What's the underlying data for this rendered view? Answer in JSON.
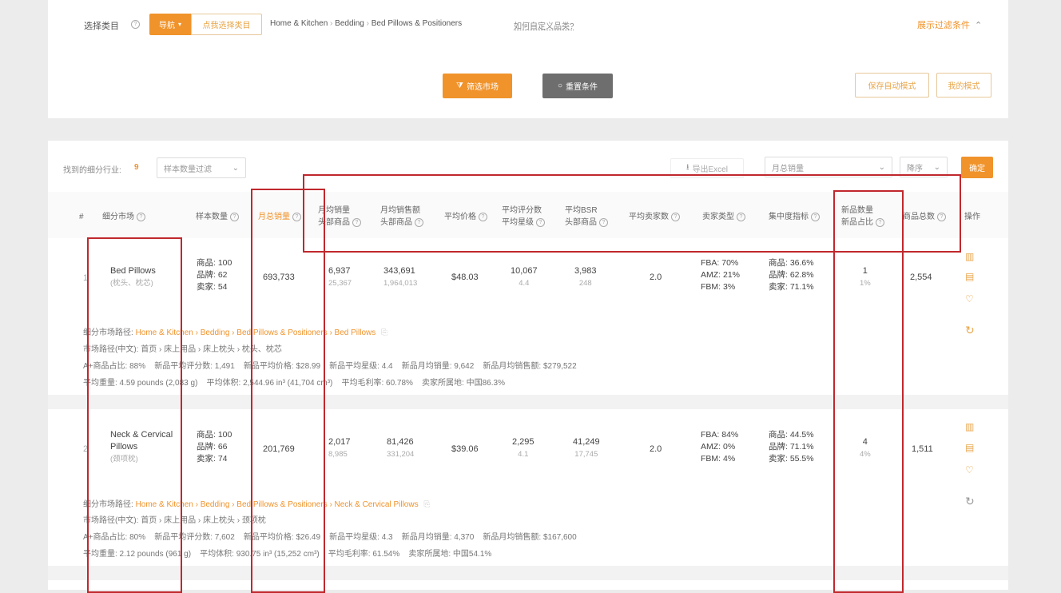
{
  "filter_bar": {
    "category_label": "选择类目",
    "nav_label": "导航",
    "select_category_btn": "点我选择类目",
    "breadcrumb": [
      "Home & Kitchen",
      "Bedding",
      "Bed Pillows & Positioners"
    ],
    "custom_category_link": "如何自定义品类?",
    "expand_filters": "展示过滤条件"
  },
  "actions": {
    "filter_market": "筛选市场",
    "reset": "重置条件",
    "save_mode": "保存自动模式",
    "my_mode": "我的模式"
  },
  "toolbar": {
    "found_label": "找到的细分行业:",
    "found_count": "9",
    "sample_filter": "样本数量过滤",
    "export": "导出Excel",
    "sort_field": "月总销量",
    "sort_order": "降序",
    "confirm": "确定"
  },
  "table": {
    "headers": {
      "idx": "#",
      "market": "细分市场",
      "sample": "样本数量",
      "monthly_sales": "月总销量",
      "avg_sales_1": "月均销量",
      "avg_sales_2": "头部商品",
      "avg_revenue_1": "月均销售额",
      "avg_revenue_2": "头部商品",
      "avg_price": "平均价格",
      "avg_rating_1": "平均评分数",
      "avg_rating_2": "平均星级",
      "avg_bsr_1": "平均BSR",
      "avg_bsr_2": "头部商品",
      "avg_sellers": "平均卖家数",
      "seller_type": "卖家类型",
      "concentration": "集中度指标",
      "new_count_1": "新品数量",
      "new_count_2": "新品占比",
      "product_total": "商品总数",
      "ops": "操作"
    },
    "rows": [
      {
        "idx": "1",
        "name": "Bed Pillows",
        "name_cn": "(枕头、枕芯)",
        "sample_goods": "商品: 100",
        "sample_brand": "品牌: 62",
        "sample_seller": "卖家: 54",
        "monthly_sales": "693,733",
        "avg_sales": "6,937",
        "avg_sales_top": "25,367",
        "avg_revenue": "343,691",
        "avg_revenue_top": "1,964,013",
        "avg_price": "$48.03",
        "avg_rating_count": "10,067",
        "avg_stars": "4.4",
        "avg_bsr": "3,983",
        "avg_bsr_top": "248",
        "avg_sellers": "2.0",
        "fba": "FBA: 70%",
        "amz": "AMZ: 21%",
        "fbm": "FBM: 3%",
        "conc_goods": "商品: 36.6%",
        "conc_brand": "品牌: 62.8%",
        "conc_seller": "卖家: 71.1%",
        "new_count": "1",
        "new_ratio": "1%",
        "product_total": "2,554",
        "path_label": "细分市场路径:",
        "path_en": "Home & Kitchen › Bedding › Bed Pillows & Positioners › Bed Pillows",
        "path_cn_label": "市场路径(中文):",
        "path_cn": "首页 › 床上用品 › 床上枕头 › 枕头、枕芯",
        "stats_line1": "A+商品占比: 88%    新品平均评分数: 1,491    新品平均价格: $28.99    新品平均星级: 4.4    新品月均销量: 9,642    新品月均销售额: $279,522",
        "stats_line2": "平均重量: 4.59 pounds (2,083 g)    平均体积: 2,544.96 in³ (41,704 cm³)    平均毛利率: 60.78%    卖家所属地: 中国86.3%"
      },
      {
        "idx": "2",
        "name": "Neck & Cervical Pillows",
        "name_cn": "(颈项枕)",
        "sample_goods": "商品: 100",
        "sample_brand": "品牌: 66",
        "sample_seller": "卖家: 74",
        "monthly_sales": "201,769",
        "avg_sales": "2,017",
        "avg_sales_top": "8,985",
        "avg_revenue": "81,426",
        "avg_revenue_top": "331,204",
        "avg_price": "$39.06",
        "avg_rating_count": "2,295",
        "avg_stars": "4.1",
        "avg_bsr": "41,249",
        "avg_bsr_top": "17,745",
        "avg_sellers": "2.0",
        "fba": "FBA: 84%",
        "amz": "AMZ: 0%",
        "fbm": "FBM: 4%",
        "conc_goods": "商品: 44.5%",
        "conc_brand": "品牌: 71.1%",
        "conc_seller": "卖家: 55.5%",
        "new_count": "4",
        "new_ratio": "4%",
        "product_total": "1,511",
        "path_label": "细分市场路径:",
        "path_en": "Home & Kitchen › Bedding › Bed Pillows & Positioners › Neck & Cervical Pillows",
        "path_cn_label": "市场路径(中文):",
        "path_cn": "首页 › 床上用品 › 床上枕头 › 颈项枕",
        "stats_line1": "A+商品占比: 80%    新品平均评分数: 7,602    新品平均价格: $26.49    新品平均星级: 4.3    新品月均销量: 4,370    新品月均销售额: $167,600",
        "stats_line2": "平均重量: 2.12 pounds (961 g)    平均体积: 930.75 in³ (15,252 cm³)    平均毛利率: 61.54%    卖家所属地: 中国54.1%"
      }
    ]
  }
}
